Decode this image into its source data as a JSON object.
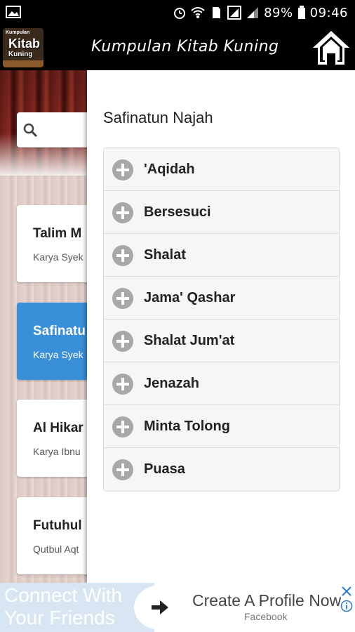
{
  "status_bar": {
    "battery": "89%",
    "time": "09:46"
  },
  "app_bar": {
    "logo_lines": [
      "Kumpulan",
      "Kitab",
      "Kuning"
    ],
    "title": "Kumpulan Kitab Kuning"
  },
  "background_list": {
    "items": [
      {
        "title": "Talim M",
        "subtitle": "Karya Syek",
        "active": false
      },
      {
        "title": "Safinatu",
        "subtitle": "Karya Syek",
        "active": true
      },
      {
        "title": "Al Hikar",
        "subtitle": "Karya Ibnu",
        "active": false
      },
      {
        "title": "Futuhul",
        "subtitle": "Qutbul Aqt",
        "active": false
      }
    ]
  },
  "drawer": {
    "title": "Safinatun Najah",
    "items": [
      {
        "label": "'Aqidah"
      },
      {
        "label": "Bersesuci"
      },
      {
        "label": "Shalat"
      },
      {
        "label": "Jama' Qashar"
      },
      {
        "label": "Shalat Jum'at"
      },
      {
        "label": "Jenazah"
      },
      {
        "label": "Minta Tolong"
      },
      {
        "label": "Puasa"
      }
    ]
  },
  "ad": {
    "left_line1": "Connect With",
    "left_line2": "Your Friends",
    "headline": "Create A Profile Now",
    "source": "Facebook"
  },
  "colors": {
    "accent": "#3a8fd9",
    "app_bar": "#000000",
    "plus_icon": "#a8a8a8"
  }
}
